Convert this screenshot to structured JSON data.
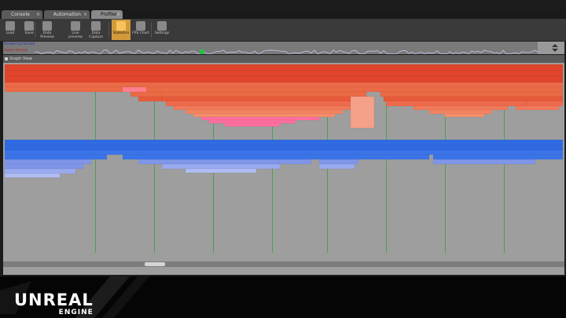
{
  "window": {
    "tabs": [
      {
        "label": "Console",
        "active": false
      },
      {
        "label": "Automation",
        "active": false
      },
      {
        "label": "Profiler",
        "active": true
      }
    ]
  },
  "toolbar": {
    "buttons": [
      {
        "label": "Load",
        "icon": "folder-icon",
        "active": false
      },
      {
        "label": "Save",
        "icon": "save-icon",
        "active": false
      },
      {
        "label": "Data Preview",
        "icon": "data-preview-icon",
        "active": false
      },
      {
        "label": "Live preview",
        "icon": "live-preview-icon",
        "active": false
      },
      {
        "label": "Data Capture",
        "icon": "data-capture-icon",
        "active": false
      },
      {
        "label": "Statistics",
        "icon": "statistics-icon",
        "active": true
      },
      {
        "label": "FPS Chart",
        "icon": "fps-chart-icon",
        "active": false
      },
      {
        "label": "Settings",
        "icon": "settings-icon",
        "active": false
      }
    ]
  },
  "timeline": {
    "rows": [
      {
        "label": "Rendering thread"
      },
      {
        "label": "Game thread"
      }
    ]
  },
  "panel": {
    "title": "Graph View"
  },
  "branding": {
    "line1": "UNREAL",
    "line2": "ENGINE"
  },
  "colors": {
    "accent": "#f7c25c",
    "flame_top": "#e0452c",
    "flame_mid": "#ea6b46",
    "flame_low": "#ff6fa0",
    "thread_blue": "#2e6be3",
    "thread_lightblue": "#7f95e8",
    "grid_green": "#4f9e4f"
  }
}
